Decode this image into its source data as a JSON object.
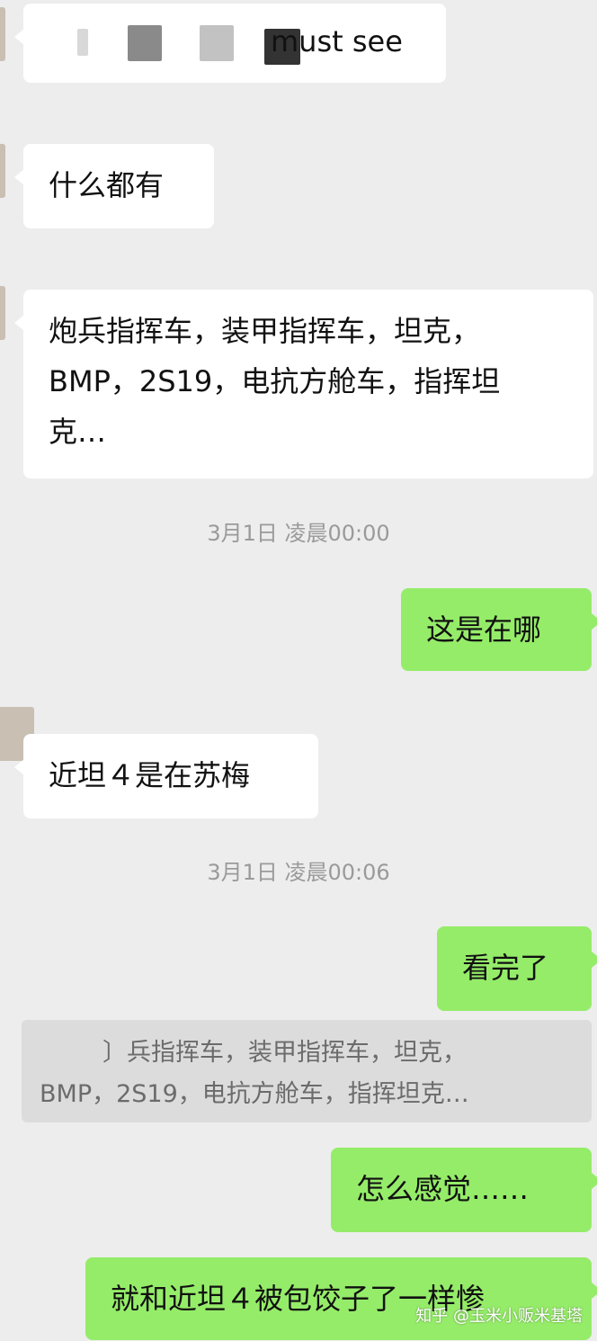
{
  "messages": [
    {
      "id": "m1",
      "side": "in",
      "text": "must see"
    },
    {
      "id": "m2",
      "side": "in",
      "text": "什么都有"
    },
    {
      "id": "m3",
      "side": "in",
      "lines": [
        "炮兵指挥车，装甲指挥车，坦克，",
        "BMP，2S19，电抗方舱车，指挥坦",
        "克…"
      ]
    },
    {
      "id": "t1",
      "type": "timestamp",
      "text": "3月1日 凌晨00:00"
    },
    {
      "id": "m4",
      "side": "out",
      "text": "这是在哪"
    },
    {
      "id": "m5",
      "side": "in",
      "text": "近坦４是在苏梅"
    },
    {
      "id": "t2",
      "type": "timestamp",
      "text": "3月1日 凌晨00:06"
    },
    {
      "id": "m6",
      "side": "out",
      "text": "看完了"
    },
    {
      "id": "q1",
      "type": "quote",
      "lines": [
        "〕兵指挥车，装甲指挥车，坦克，",
        "BMP，2S19，电抗方舱车，指挥坦克…"
      ]
    },
    {
      "id": "m7",
      "side": "out",
      "text": "怎么感觉……"
    },
    {
      "id": "m8",
      "side": "out",
      "text": "就和近坦４被包饺子了一样惨"
    }
  ],
  "watermark": {
    "text": "知乎 @玉米小贩米基塔"
  },
  "colors": {
    "background": "#ededed",
    "incoming_bubble": "#ffffff",
    "outgoing_bubble": "#95ec69",
    "timestamp_text": "#9a9a9a",
    "quote_bg": "#dcdcdc"
  }
}
